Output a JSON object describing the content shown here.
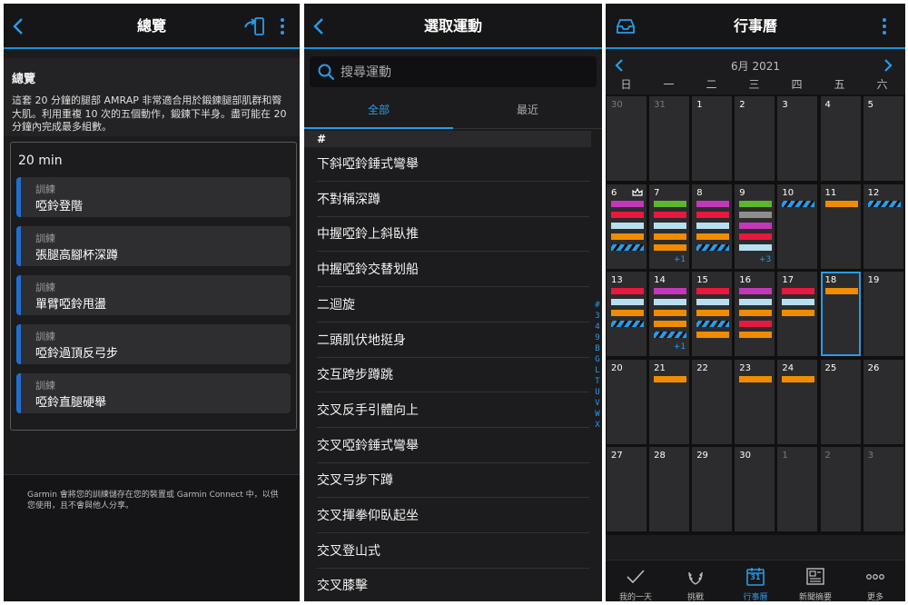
{
  "overview": {
    "header_title": "總覽",
    "section_title": "總覽",
    "description": "這套 20 分鐘的腿部 AMRAP 非常適合用於鍛鍊腿部肌群和臀大肌。利用重複 10 次的五個動作，鍛鍊下半身。盡可能在 20 分鐘內完成最多組數。",
    "duration": "20 min",
    "steps": [
      {
        "label": "訓練",
        "name": "啞鈴登階"
      },
      {
        "label": "訓練",
        "name": "張腿高腳杯深蹲"
      },
      {
        "label": "訓練",
        "name": "單臂啞鈴甩盪"
      },
      {
        "label": "訓練",
        "name": "啞鈴過頂反弓步"
      },
      {
        "label": "訓練",
        "name": "啞鈴直腿硬舉"
      }
    ],
    "footer_note": "Garmin 會將您的訓練儲存在您的裝置或 Garmin Connect 中，以供您使用，且不會與他人分享。"
  },
  "select_exercise": {
    "header_title": "選取運動",
    "search_placeholder": "搜尋運動",
    "tabs": [
      "全部",
      "最近"
    ],
    "section_header": "#",
    "exercises": [
      "下斜啞鈴錘式彎舉",
      "不對稱深蹲",
      "中握啞鈴上斜臥推",
      "中握啞鈴交替划船",
      "二迴旋",
      "二頭肌伏地挺身",
      "交互跨步蹲跳",
      "交叉反手引體向上",
      "交叉啞鈴錘式彎舉",
      "交叉弓步下蹲",
      "交叉揮拳仰臥起坐",
      "交叉登山式",
      "交叉膝擊"
    ],
    "index": [
      "#",
      "3",
      "4",
      "9",
      "B",
      "G",
      "L",
      "T",
      "U",
      "V",
      "W",
      "X"
    ]
  },
  "calendar": {
    "header_title": "行事曆",
    "month": "6月 2021",
    "weekdays": [
      "日",
      "一",
      "二",
      "三",
      "四",
      "五",
      "六"
    ],
    "colors": {
      "magenta": "#c238b8",
      "red": "#e8183e",
      "lightblue": "#b8dff0",
      "orange": "#f08c00",
      "green": "#5cb82a",
      "gray": "#8e8e8e",
      "stripe": "#2a9be8"
    },
    "days": [
      {
        "n": "30",
        "dim": true,
        "bars": []
      },
      {
        "n": "31",
        "dim": true,
        "bars": []
      },
      {
        "n": "1",
        "bars": []
      },
      {
        "n": "2",
        "bars": []
      },
      {
        "n": "3",
        "bars": []
      },
      {
        "n": "4",
        "bars": []
      },
      {
        "n": "5",
        "bars": []
      },
      {
        "n": "6",
        "crown": true,
        "bars": [
          "magenta",
          "red",
          "lightblue",
          "orange",
          "stripe"
        ]
      },
      {
        "n": "7",
        "more": "+1",
        "bars": [
          "green",
          "red",
          "lightblue",
          "orange",
          "orange"
        ]
      },
      {
        "n": "8",
        "bars": [
          "magenta",
          "red",
          "lightblue",
          "orange",
          "stripe"
        ]
      },
      {
        "n": "9",
        "more": "+3",
        "bars": [
          "green",
          "gray",
          "magenta",
          "red",
          "lightblue"
        ]
      },
      {
        "n": "10",
        "bars": [
          "stripe"
        ]
      },
      {
        "n": "11",
        "bars": [
          "orange"
        ]
      },
      {
        "n": "12",
        "bars": [
          "stripe"
        ]
      },
      {
        "n": "13",
        "bars": [
          "red",
          "lightblue",
          "orange",
          "stripe"
        ]
      },
      {
        "n": "14",
        "more": "+1",
        "bars": [
          "magenta",
          "lightblue",
          "orange",
          "orange",
          "stripe"
        ]
      },
      {
        "n": "15",
        "bars": [
          "red",
          "lightblue",
          "orange",
          "stripe",
          "orange"
        ]
      },
      {
        "n": "16",
        "bars": [
          "magenta",
          "lightblue",
          "orange",
          "red",
          "orange"
        ]
      },
      {
        "n": "17",
        "bars": [
          "red",
          "lightblue",
          "orange"
        ]
      },
      {
        "n": "18",
        "today": true,
        "bars": [
          "orange"
        ]
      },
      {
        "n": "19",
        "bars": []
      },
      {
        "n": "20",
        "bars": []
      },
      {
        "n": "21",
        "bars": [
          "orange"
        ]
      },
      {
        "n": "22",
        "bars": []
      },
      {
        "n": "23",
        "bars": [
          "orange"
        ]
      },
      {
        "n": "24",
        "bars": [
          "orange"
        ]
      },
      {
        "n": "25",
        "bars": []
      },
      {
        "n": "26",
        "bars": []
      },
      {
        "n": "27",
        "bars": []
      },
      {
        "n": "28",
        "bars": []
      },
      {
        "n": "29",
        "bars": []
      },
      {
        "n": "30",
        "bars": []
      },
      {
        "n": "1",
        "dim": true,
        "bars": []
      },
      {
        "n": "2",
        "dim": true,
        "bars": []
      },
      {
        "n": "3",
        "dim": true,
        "bars": []
      }
    ],
    "tabbar": [
      {
        "label": "我的一天",
        "icon": "check-icon"
      },
      {
        "label": "挑戰",
        "icon": "laurel-icon"
      },
      {
        "label": "行事曆",
        "icon": "calendar-icon",
        "active": true
      },
      {
        "label": "新聞摘要",
        "icon": "news-icon"
      },
      {
        "label": "更多",
        "icon": "more-dots-icon"
      }
    ],
    "tab_calendar_day": "31"
  }
}
